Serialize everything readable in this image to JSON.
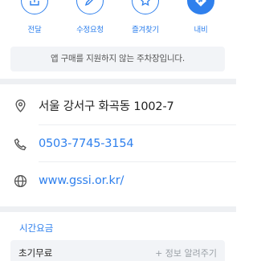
{
  "actions": [
    {
      "label": "전달",
      "icon": "share-icon"
    },
    {
      "label": "수정요청",
      "icon": "pencil-icon"
    },
    {
      "label": "즐겨찾기",
      "icon": "star-icon"
    },
    {
      "label": "내비",
      "icon": "navigation-icon"
    }
  ],
  "notice": "앱 구매를 지원하지 않는 주차장입니다.",
  "info": {
    "address": "서울 강서구 화곡동 1002-7",
    "phone": "0503-7745-3154",
    "website": "www.gssi.or.kr/"
  },
  "pricing": {
    "section_title": "시간요금",
    "fee_label": "초기무료",
    "report_link": "+ 정보 알려주기"
  },
  "colors": {
    "accent": "#2f80ed",
    "notice_bg": "#f2f4f7"
  }
}
